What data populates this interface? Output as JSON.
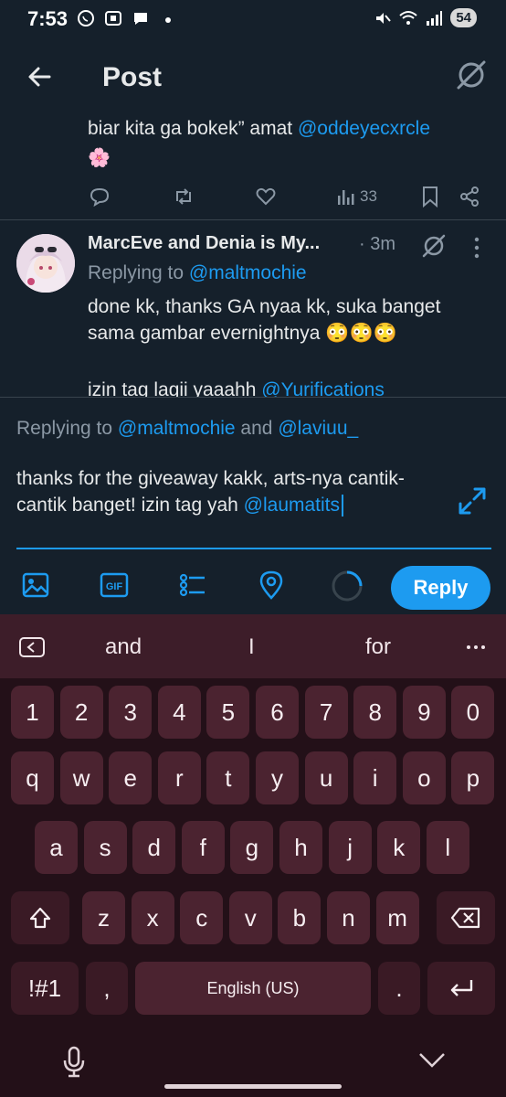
{
  "status_bar": {
    "time": "7:53",
    "battery": "54"
  },
  "header": {
    "title": "Post"
  },
  "previous_post": {
    "text_plain": "biar kita ga bokek” amat ",
    "mention": "@oddeyecxrcle",
    "emoji": "🌸",
    "views": "33"
  },
  "reply_post": {
    "author": "MarcEve and Denia is My...",
    "time": "· 3m",
    "replying_label": "Replying to ",
    "replying_to": "@maltmochie",
    "text_line1": "done kk, thanks GA nyaa kk, suka banget",
    "text_line2": "sama gambar evernightnya 😳😳😳",
    "text_line3": "izin tag lagii yaaahh ",
    "text_line3_mention": "@Yurifications"
  },
  "compose": {
    "replying_label": "Replying to ",
    "replying_to_1": "@maltmochie",
    "replying_and": " and ",
    "replying_to_2": "@laviuu_",
    "input_text": "thanks for the giveaway kakk, arts-nya cantik-cantik banget! izin tag yah ",
    "input_mention": "@laumatits",
    "reply_label": "Reply",
    "gif_label": "GIF"
  },
  "keyboard": {
    "suggestions": [
      "and",
      "I",
      "for"
    ],
    "row_numbers": [
      "1",
      "2",
      "3",
      "4",
      "5",
      "6",
      "7",
      "8",
      "9",
      "0"
    ],
    "row_q": [
      "q",
      "w",
      "e",
      "r",
      "t",
      "y",
      "u",
      "i",
      "o",
      "p"
    ],
    "row_a": [
      "a",
      "s",
      "d",
      "f",
      "g",
      "h",
      "j",
      "k",
      "l"
    ],
    "row_z": [
      "z",
      "x",
      "c",
      "v",
      "b",
      "n",
      "m"
    ],
    "sym_label": "!#1",
    "comma": ",",
    "space_label": "English (US)",
    "period": "."
  },
  "colors": {
    "accent": "#1d9bf0",
    "background": "#15202b",
    "keyboard": "#231018"
  }
}
